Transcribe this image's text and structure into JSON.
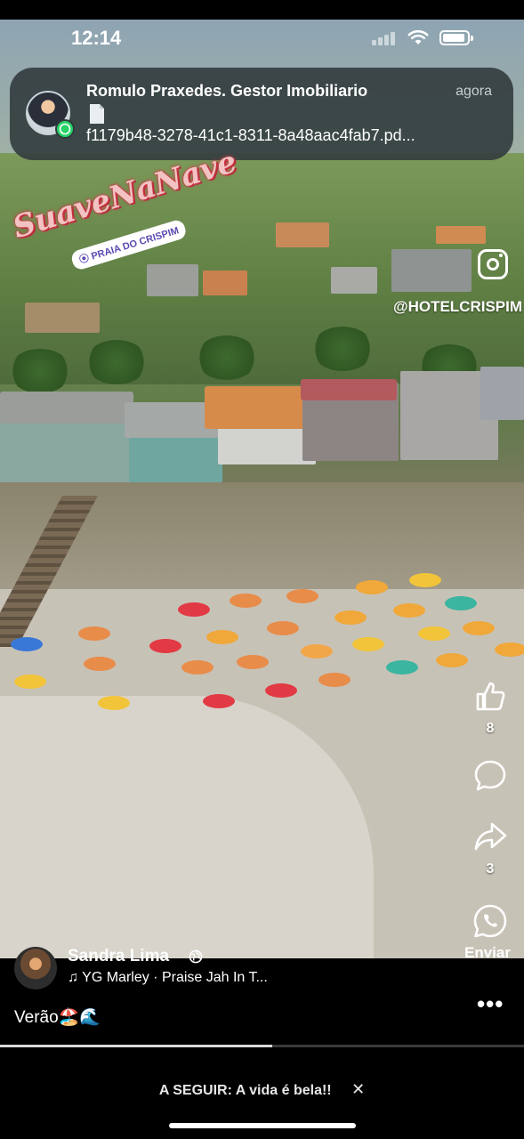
{
  "status_bar": {
    "time": "12:14"
  },
  "notification": {
    "sender": "Romulo Praxedes. Gestor Imobiliario",
    "when": "agora",
    "filename": "f1179b48-3278-41c1-8311-8a48aac4fab7.pd...",
    "app_icon": "whatsapp-icon",
    "attachment_icon": "document-icon"
  },
  "overlay": {
    "brand_script": "SuaveNaNave",
    "location_tag": "PRAIA DO CRISPIM",
    "instagram_handle": "@HOTELCRISPIM"
  },
  "actions": {
    "like_count": "8",
    "share_count": "3",
    "send_label": "Enviar"
  },
  "post": {
    "author": "Sandra Lima",
    "song": "YG Marley · Praise Jah In T...",
    "caption": "Verão🏖️🌊",
    "progress": 0.52
  },
  "up_next": {
    "label": "A SEGUIR:",
    "title": "A vida é bela!!"
  },
  "colors": {
    "notification_bg": "#343e40",
    "whatsapp_green": "#25d366"
  }
}
